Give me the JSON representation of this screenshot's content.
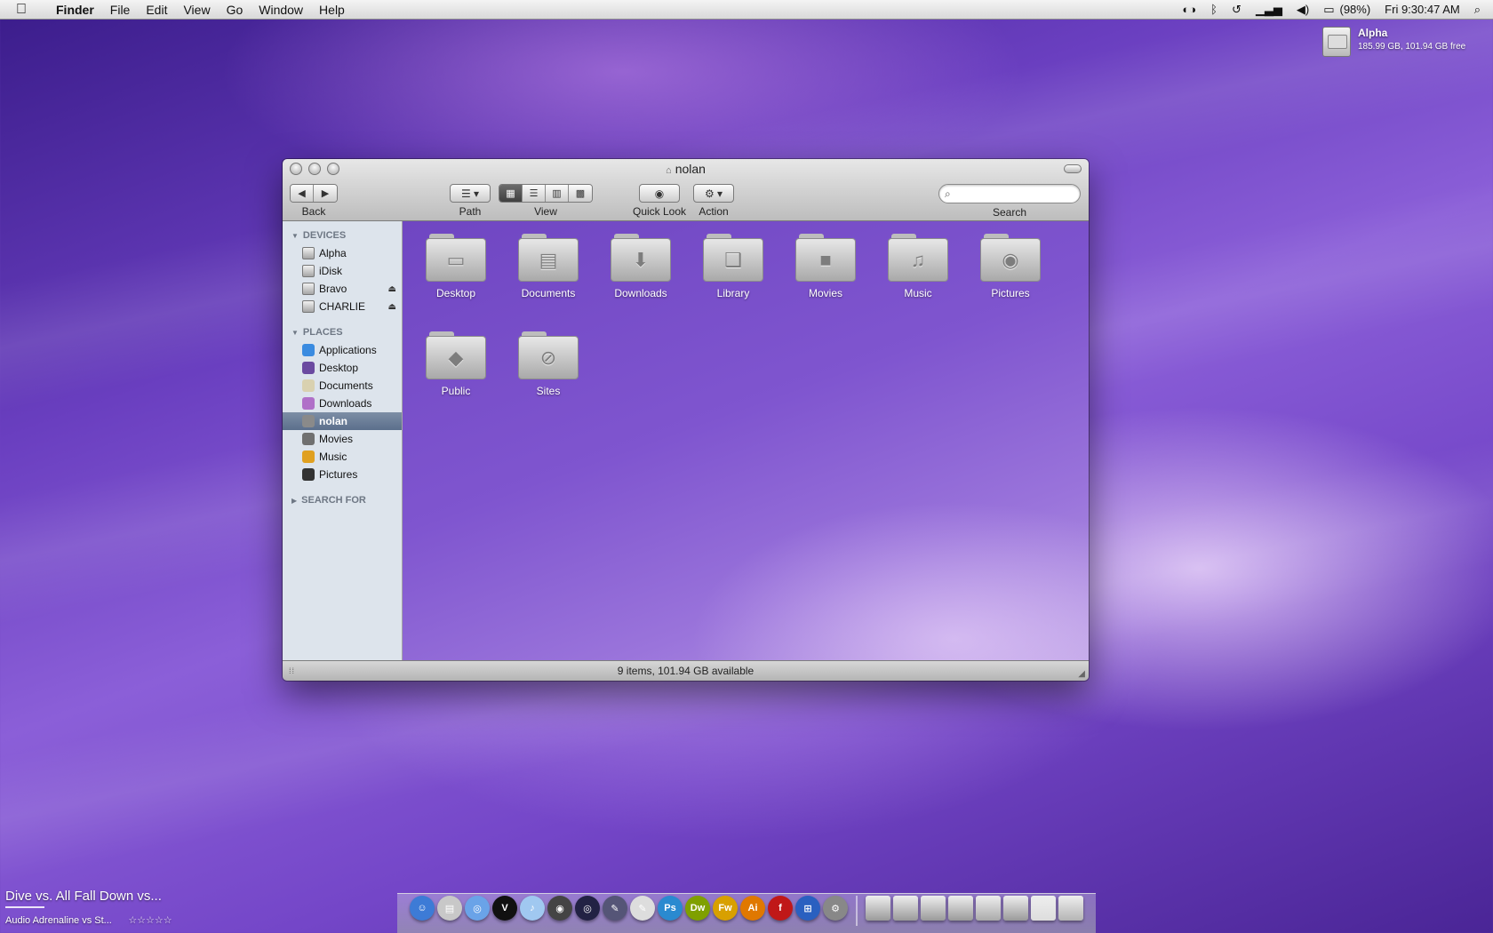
{
  "menubar": {
    "app_name": "Finder",
    "menus": [
      "File",
      "Edit",
      "View",
      "Go",
      "Window",
      "Help"
    ],
    "battery": "(98%)",
    "clock": "Fri 9:30:47 AM"
  },
  "desktop": {
    "drive": {
      "name": "Alpha",
      "capacity": "185.99 GB, 101.94 GB free"
    }
  },
  "window": {
    "title": "nolan",
    "toolbar": {
      "back_label": "Back",
      "path_label": "Path",
      "view_label": "View",
      "quicklook_label": "Quick Look",
      "action_label": "Action",
      "search_label": "Search",
      "search_value": ""
    },
    "sidebar": {
      "devices_header": "DEVICES",
      "devices": [
        {
          "label": "Alpha",
          "icon": "hard-drive-icon"
        },
        {
          "label": "iDisk",
          "icon": "idisk-icon"
        },
        {
          "label": "Bravo",
          "icon": "hard-drive-icon",
          "eject": true
        },
        {
          "label": "CHARLIE",
          "icon": "hard-drive-icon",
          "eject": true
        }
      ],
      "places_header": "PLACES",
      "places": [
        {
          "label": "Applications",
          "icon": "applications-icon",
          "color": "#3a8be0"
        },
        {
          "label": "Desktop",
          "icon": "desktop-icon",
          "color": "#6b4aa0"
        },
        {
          "label": "Documents",
          "icon": "documents-icon",
          "color": "#d9d1b0"
        },
        {
          "label": "Downloads",
          "icon": "downloads-icon",
          "color": "#b070c8"
        },
        {
          "label": "nolan",
          "icon": "home-icon",
          "color": "#8a8a8a",
          "selected": true
        },
        {
          "label": "Movies",
          "icon": "movies-icon",
          "color": "#707070"
        },
        {
          "label": "Music",
          "icon": "music-icon",
          "color": "#e0a020"
        },
        {
          "label": "Pictures",
          "icon": "pictures-icon",
          "color": "#333333"
        }
      ],
      "search_for_header": "SEARCH FOR"
    },
    "folders": [
      {
        "label": "Desktop",
        "icon": "desktop-folder-icon",
        "glyph": "▭"
      },
      {
        "label": "Documents",
        "icon": "documents-folder-icon",
        "glyph": "▤"
      },
      {
        "label": "Downloads",
        "icon": "downloads-folder-icon",
        "glyph": "⬇"
      },
      {
        "label": "Library",
        "icon": "library-folder-icon",
        "glyph": "❑"
      },
      {
        "label": "Movies",
        "icon": "movies-folder-icon",
        "glyph": "■"
      },
      {
        "label": "Music",
        "icon": "music-folder-icon",
        "glyph": "♫"
      },
      {
        "label": "Pictures",
        "icon": "pictures-folder-icon",
        "glyph": "◉"
      },
      {
        "label": "Public",
        "icon": "public-folder-icon",
        "glyph": "◆"
      },
      {
        "label": "Sites",
        "icon": "sites-folder-icon",
        "glyph": "⊘"
      }
    ],
    "status": "9 items, 101.94 GB available"
  },
  "now_playing": {
    "song": "Dive vs. All Fall Down vs...",
    "artist": "Audio Adrenaline vs St...",
    "stars": "☆☆☆☆☆"
  },
  "dock": {
    "apps": [
      {
        "name": "finder-icon",
        "color": "#3d7bd6",
        "glyph": "☺"
      },
      {
        "name": "preview-icon",
        "color": "#c8c8c8",
        "glyph": "▤"
      },
      {
        "name": "safari-icon",
        "color": "#6aa3e8",
        "glyph": "◎"
      },
      {
        "name": "tuxedo-icon",
        "color": "#111111",
        "glyph": "V"
      },
      {
        "name": "itunes-icon",
        "color": "#a0c8f0",
        "glyph": "♪"
      },
      {
        "name": "camera-icon",
        "color": "#444444",
        "glyph": "◉"
      },
      {
        "name": "lens-icon",
        "color": "#222244",
        "glyph": "◎"
      },
      {
        "name": "pen-icon",
        "color": "#555577",
        "glyph": "✎"
      },
      {
        "name": "text-edit-icon",
        "color": "#dddddd",
        "glyph": "✎"
      },
      {
        "name": "photoshop-icon",
        "color": "#2a8ad0",
        "glyph": "Ps"
      },
      {
        "name": "dreamweaver-icon",
        "color": "#7fa000",
        "glyph": "Dw"
      },
      {
        "name": "fireworks-icon",
        "color": "#d8a000",
        "glyph": "Fw"
      },
      {
        "name": "illustrator-icon",
        "color": "#e07800",
        "glyph": "Ai"
      },
      {
        "name": "flash-icon",
        "color": "#c01818",
        "glyph": "f"
      },
      {
        "name": "windows-icon",
        "color": "#2a60c0",
        "glyph": "⊞"
      },
      {
        "name": "system-prefs-icon",
        "color": "#888888",
        "glyph": "⚙"
      }
    ],
    "stacks": [
      {
        "name": "stack-icon-1",
        "color": "#9a9a9a"
      },
      {
        "name": "stack-icon-2",
        "color": "#9a9a9a"
      },
      {
        "name": "stack-icon-3",
        "color": "#9a9a9a"
      },
      {
        "name": "stack-icon-4",
        "color": "#9a9a9a"
      },
      {
        "name": "stack-icon-5",
        "color": "#aaaaaa"
      },
      {
        "name": "stack-icon-6",
        "color": "#9a9a9a"
      },
      {
        "name": "stack-icon-7",
        "color": "#dddddd"
      },
      {
        "name": "trash-icon",
        "color": "#b5b5b5"
      }
    ]
  }
}
